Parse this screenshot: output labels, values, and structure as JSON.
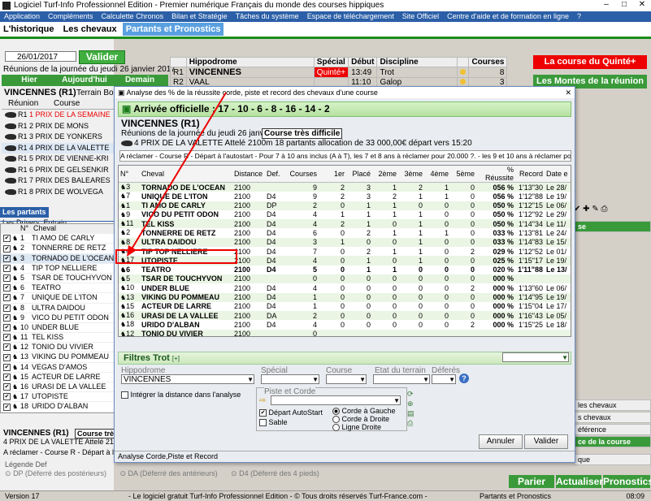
{
  "window": {
    "title": "Logiciel Turf-Info Professionnel Edition - Premier numérique Français du monde des courses hippiques"
  },
  "menu": [
    "Application",
    "Compléments",
    "Calculette Chronos",
    "Bilan et Stratégie",
    "Tâches du système",
    "Espace de téléchargement",
    "Site Officiel",
    "Centre d'aide et de formation en ligne",
    "?"
  ],
  "top_tabs": [
    "L'historique",
    "Les chevaux",
    "Partants et Pronostics"
  ],
  "left": {
    "date": "26/01/2017",
    "valider": "Valider",
    "reunion_info": "Réunions de la journée du jeudi 26 janvier 2017",
    "nav": [
      "Hier",
      "Aujourd'hui",
      "Demain"
    ],
    "vincennes_title": "VINCENNES (R1)",
    "terrain": "Terrain Bon",
    "col_reunion": "Réunion",
    "col_course": "Course",
    "courses": [
      {
        "r": "R1",
        "name": "1 PRIX DE LA SEMAINE",
        "red": true
      },
      {
        "r": "R1",
        "name": "2 PRIX DE MONS",
        "red": false
      },
      {
        "r": "R1",
        "name": "3 PRIX DE YONKERS",
        "red": false
      },
      {
        "r": "R1",
        "name": "4 PRIX DE LA VALETTE",
        "red": false
      },
      {
        "r": "R1",
        "name": "5 PRIX DE VIENNE-KRI",
        "red": false
      },
      {
        "r": "R1",
        "name": "6 PRIX DE GELSENKIR",
        "red": false
      },
      {
        "r": "R1",
        "name": "7 PRIX DES BALEARES",
        "red": false
      },
      {
        "r": "R1",
        "name": "8 PRIX DE WOLVEGA",
        "red": false
      }
    ],
    "tabs": [
      "Les partants",
      "Les Drivers, Entrain"
    ],
    "grid_headers": [
      "N°",
      "Cheval"
    ],
    "partants": [
      {
        "n": "1",
        "name": "TI AMO DE CARLY"
      },
      {
        "n": "2",
        "name": "TONNERRE DE RETZ"
      },
      {
        "n": "3",
        "name": "TORNADO DE L'OCEAN"
      },
      {
        "n": "4",
        "name": "TIP TOP NELLIERE"
      },
      {
        "n": "5",
        "name": "TSAR DE TOUCHYVON"
      },
      {
        "n": "6",
        "name": "TEATRO"
      },
      {
        "n": "7",
        "name": "UNIQUE DE L'ITON"
      },
      {
        "n": "8",
        "name": "ULTRA DAIDOU"
      },
      {
        "n": "9",
        "name": "VICO DU PETIT ODON"
      },
      {
        "n": "10",
        "name": "UNDER BLUE"
      },
      {
        "n": "11",
        "name": "TEL KISS"
      },
      {
        "n": "12",
        "name": "TONIO DU VIVIER"
      },
      {
        "n": "13",
        "name": "VIKING DU POMMEAU"
      },
      {
        "n": "14",
        "name": "VEGAS D'AMOS"
      },
      {
        "n": "15",
        "name": "ACTEUR DE LARRE"
      },
      {
        "n": "16",
        "name": "URASI DE LA VALLEE"
      },
      {
        "n": "17",
        "name": "UTOPISTE"
      },
      {
        "n": "18",
        "name": "URIDO D'ALBAN"
      }
    ],
    "bottom_title": "VINCENNES (R1)",
    "bottom_btn": "Course très",
    "bottom_prix": "4 PRIX DE LA VALETTE Attelé 2100m 1",
    "bottom_cond": "A réclamer - Course R - Départ à l'autos",
    "legende": "Légende Def",
    "legend_items": [
      "DP (Déferré des postérieurs)",
      "DA (Déferré des antérieurs)",
      "D4 (Déferré des 4 pieds)"
    ]
  },
  "program": {
    "headers": [
      "",
      "Hippodrome",
      "Spécial",
      "Début",
      "Discipline",
      "",
      "Courses"
    ],
    "rows": [
      {
        "r": "R1",
        "hippo": "VINCENNES",
        "special": "Quinté+",
        "debut": "13:49",
        "disc": "Trot",
        "courses": "8"
      },
      {
        "r": "R2",
        "hippo": "VAAL",
        "special": "",
        "debut": "11:10",
        "disc": "Galop",
        "courses": "3"
      }
    ],
    "quinte_btn": "La course du Quinté+",
    "montes_btn": "Les Montes de la réunion"
  },
  "dialog": {
    "title": "Analyse des % de la réussite corde, piste et record des chevaux d'une course",
    "arrivee": "Arrivée officielle : 17 - 10 - 6 - 8 - 16 - 14 - 2",
    "vincennes": "VINCENNES (R1)",
    "reunions": "Réunions de la journée du jeudi 26 janvier 2017",
    "difficile": "Course très difficile",
    "prix": "4 PRIX DE LA VALETTE Attelé 2100m 18 partants allocation de 33 000,00€ départ vers 15:20",
    "conditions": "A réclamer - Course R - Départ à l'autostart - Pour 7 à 10 ans inclus (A à T), les 7 et 8 ans à réclamer pour 20.000 ?. - les 9 et 10 ans à réclamer pour 15.000",
    "headers": [
      "N°",
      "Cheval",
      "Distance",
      "Def.",
      "Courses",
      "1er",
      "Placé",
      "2ème",
      "3ème",
      "4ème",
      "5ème",
      "% Réussite",
      "Record",
      "Date e"
    ],
    "rows": [
      [
        "3",
        "TORNADO DE L'OCEAN",
        "2100",
        "",
        "9",
        "2",
        "3",
        "1",
        "2",
        "1",
        "0",
        "056 %",
        "1'13\"30",
        "Le 28/"
      ],
      [
        "7",
        "UNIQUE DE L'ITON",
        "2100",
        "D4",
        "9",
        "2",
        "3",
        "2",
        "1",
        "1",
        "0",
        "056 %",
        "1'12\"88",
        "Le 19/"
      ],
      [
        "1",
        "TI AMO DE CARLY",
        "2100",
        "DP",
        "2",
        "0",
        "1",
        "1",
        "0",
        "0",
        "0",
        "050 %",
        "1'12\"15",
        "Le 06/"
      ],
      [
        "9",
        "VICO DU PETIT ODON",
        "2100",
        "D4",
        "4",
        "1",
        "1",
        "1",
        "1",
        "0",
        "0",
        "050 %",
        "1'12\"92",
        "Le 29/"
      ],
      [
        "11",
        "TEL KISS",
        "2100",
        "D4",
        "4",
        "2",
        "1",
        "0",
        "1",
        "0",
        "0",
        "050 %",
        "1'14\"34",
        "Le 11/"
      ],
      [
        "2",
        "TONNERRE DE RETZ",
        "2100",
        "D4",
        "6",
        "0",
        "2",
        "1",
        "1",
        "1",
        "0",
        "033 %",
        "1'13\"81",
        "Le 24/"
      ],
      [
        "8",
        "ULTRA DAIDOU",
        "2100",
        "D4",
        "3",
        "1",
        "0",
        "0",
        "1",
        "0",
        "0",
        "033 %",
        "1'14\"83",
        "Le 15/"
      ],
      [
        "4",
        "TIP TOP NELLIERE",
        "2100",
        "D4",
        "7",
        "0",
        "2",
        "1",
        "1",
        "0",
        "2",
        "029 %",
        "1'12\"52",
        "Le 01/"
      ],
      [
        "17",
        "UTOPISTE",
        "2100",
        "D4",
        "4",
        "0",
        "1",
        "0",
        "1",
        "0",
        "0",
        "025 %",
        "1'15\"17",
        "Le 19/"
      ],
      [
        "6",
        "TEATRO",
        "2100",
        "D4",
        "5",
        "0",
        "1",
        "1",
        "0",
        "0",
        "0",
        "020 %",
        "1'11\"88",
        "Le 13/"
      ],
      [
        "5",
        "TSAR DE TOUCHYVON",
        "2100",
        "",
        "0",
        "0",
        "0",
        "0",
        "0",
        "0",
        "0",
        "000 %",
        "",
        ""
      ],
      [
        "10",
        "UNDER BLUE",
        "2100",
        "D4",
        "4",
        "0",
        "0",
        "0",
        "0",
        "0",
        "2",
        "000 %",
        "1'13\"60",
        "Le 06/"
      ],
      [
        "13",
        "VIKING DU POMMEAU",
        "2100",
        "D4",
        "1",
        "0",
        "0",
        "0",
        "0",
        "0",
        "0",
        "000 %",
        "1'14\"95",
        "Le 19/"
      ],
      [
        "15",
        "ACTEUR DE LARRE",
        "2100",
        "D4",
        "1",
        "0",
        "0",
        "0",
        "0",
        "0",
        "0",
        "000 %",
        "1'15\"04",
        "Le 17/"
      ],
      [
        "16",
        "URASI DE LA VALLEE",
        "2100",
        "DA",
        "2",
        "0",
        "0",
        "0",
        "0",
        "0",
        "0",
        "000 %",
        "1'16\"43",
        "Le 05/"
      ],
      [
        "18",
        "URIDO D'ALBAN",
        "2100",
        "D4",
        "4",
        "0",
        "0",
        "0",
        "0",
        "0",
        "2",
        "000 %",
        "1'15\"25",
        "Le 18/"
      ],
      [
        "12",
        "TONIO DU VIVIER",
        "2100",
        "",
        "0",
        "",
        "",
        "",
        "",
        "",
        "",
        "",
        "",
        ""
      ],
      [
        "14",
        "VEGAS D'AMOS",
        "2100",
        "",
        "0",
        "",
        "",
        "",
        "",
        "",
        "",
        "",
        "",
        ""
      ]
    ],
    "filtres": "Filtres Trot",
    "labels": {
      "hippodrome": "Hippodrome",
      "special": "Spécial",
      "course": "Course",
      "etat": "Etat du terrain",
      "deferes": "Déferés",
      "piste": "Piste et Corde"
    },
    "hippodrome_value": "VINCENNES",
    "integrer": "Intégrer la distance dans l'analyse",
    "depart_auto": "Départ AutoStart",
    "sable": "Sable",
    "corde_gauche": "Corde à Gauche",
    "corde_droite": "Corde à Droite",
    "ligne_droite": "Ligne Droite",
    "annuler": "Annuler",
    "valider": "Valider",
    "status": "Analyse Corde,Piste et Record"
  },
  "right_panel": {
    "items": [
      "se",
      "les chevaux",
      "s chevaux",
      "éférence",
      "ce de la course",
      "que"
    ],
    "buttons": [
      "Parier",
      "Actualiser",
      "Pronostics"
    ]
  },
  "statusbar": {
    "version": "Version 17",
    "footer": "- Le logiciel gratuit Turf-Info Professionnel Edition - © Tous droits réservés Turf-France.com -",
    "panel": "Partants et Pronostics",
    "time": "08:09"
  }
}
